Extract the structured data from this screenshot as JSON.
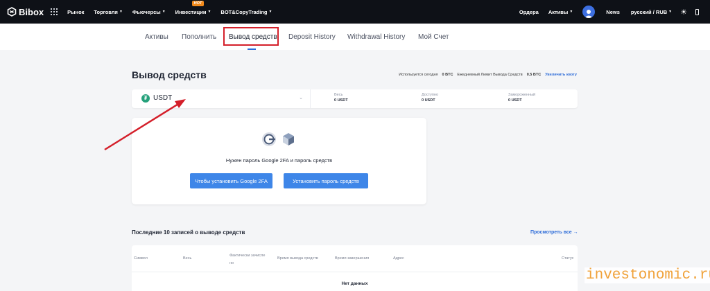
{
  "colors": {
    "accent": "#2c6bd8",
    "nav_bg": "#0e1117",
    "button": "#3e86e8",
    "highlight": "#d41f2a",
    "hot_badge": "#f28a1b",
    "usdt": "#26a17b",
    "watermark": "#f0a23a"
  },
  "nav": {
    "logo": "Bibox",
    "items": [
      "Рынок",
      "Торговля",
      "Фьючерсы",
      "Инвестиции",
      "BOT&CopyTrading"
    ],
    "hot_badge": "HOT",
    "right": {
      "orders": "Ордера",
      "assets": "Активы",
      "news": "News",
      "language": "русский / RUB"
    }
  },
  "tabs": [
    "Активы",
    "Пополнить",
    "Вывод средств",
    "Deposit History",
    "Withdrawal History",
    "Мой Счет"
  ],
  "active_tab": "Вывод средств",
  "page": {
    "title": "Вывод средств",
    "limits": {
      "used_today_label": "Используется сегодня",
      "used_today": "0 BTC",
      "daily_limit_label": "Ежедневный Лимит Вывода Средств",
      "daily_limit": "0.5 BTC",
      "increase_link": "Увеличить квоту"
    }
  },
  "coin": {
    "symbol": "USDT",
    "icon": "tether-icon",
    "stats": [
      {
        "label": "Весь",
        "value": "0 USDT"
      },
      {
        "label": "Доступно",
        "value": "0 USDT"
      },
      {
        "label": "Замороженный",
        "value": "0 USDT"
      }
    ]
  },
  "security": {
    "message": "Нужен пароль Google 2FA и пароль средств",
    "btn_2fa": "Чтобы установить Google 2FA",
    "btn_password": "Установить пароль средств"
  },
  "records": {
    "title": "Последние 10 записей о выводе средств",
    "view_all": "Просмотреть все →",
    "columns": [
      "Символ",
      "Весь",
      "Фактически зачисле но",
      "Время вывода средств",
      "Время завершения",
      "Адрес",
      "Статус"
    ],
    "empty": "Нет данных"
  },
  "watermark": "investonomic.ru"
}
